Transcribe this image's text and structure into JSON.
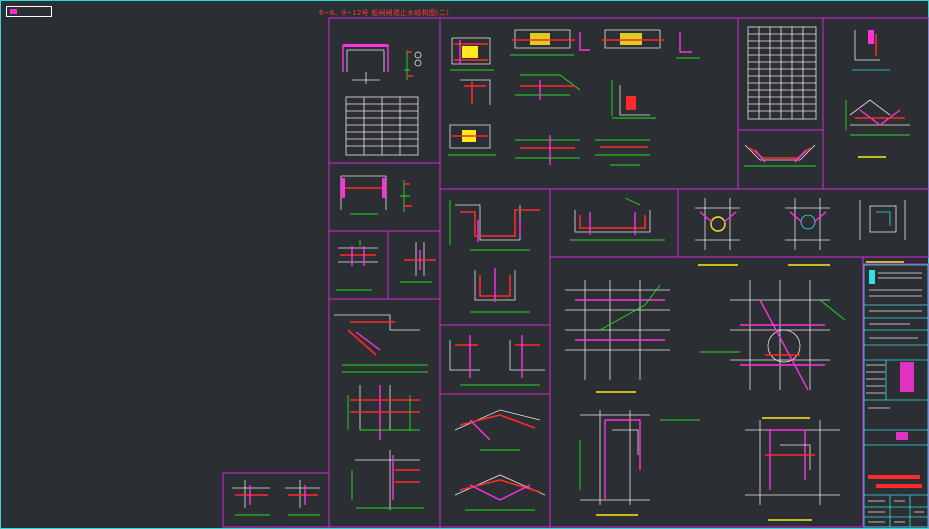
{
  "window": {
    "view_tab": "",
    "drawing_title": "6~8、9~12号  船闸闸墙止水结构图(二)"
  },
  "colors": {
    "background": "#2b2e33",
    "viewport_border": "#2fd7d7",
    "panel_border": "#d62bd6",
    "reinforcement": "#ff2a2a",
    "waterstop": "#ff33dd",
    "dimension": "#22e022",
    "fill": "#ffe81c"
  },
  "icons": {
    "view_tab": "layout-tab-icon"
  }
}
